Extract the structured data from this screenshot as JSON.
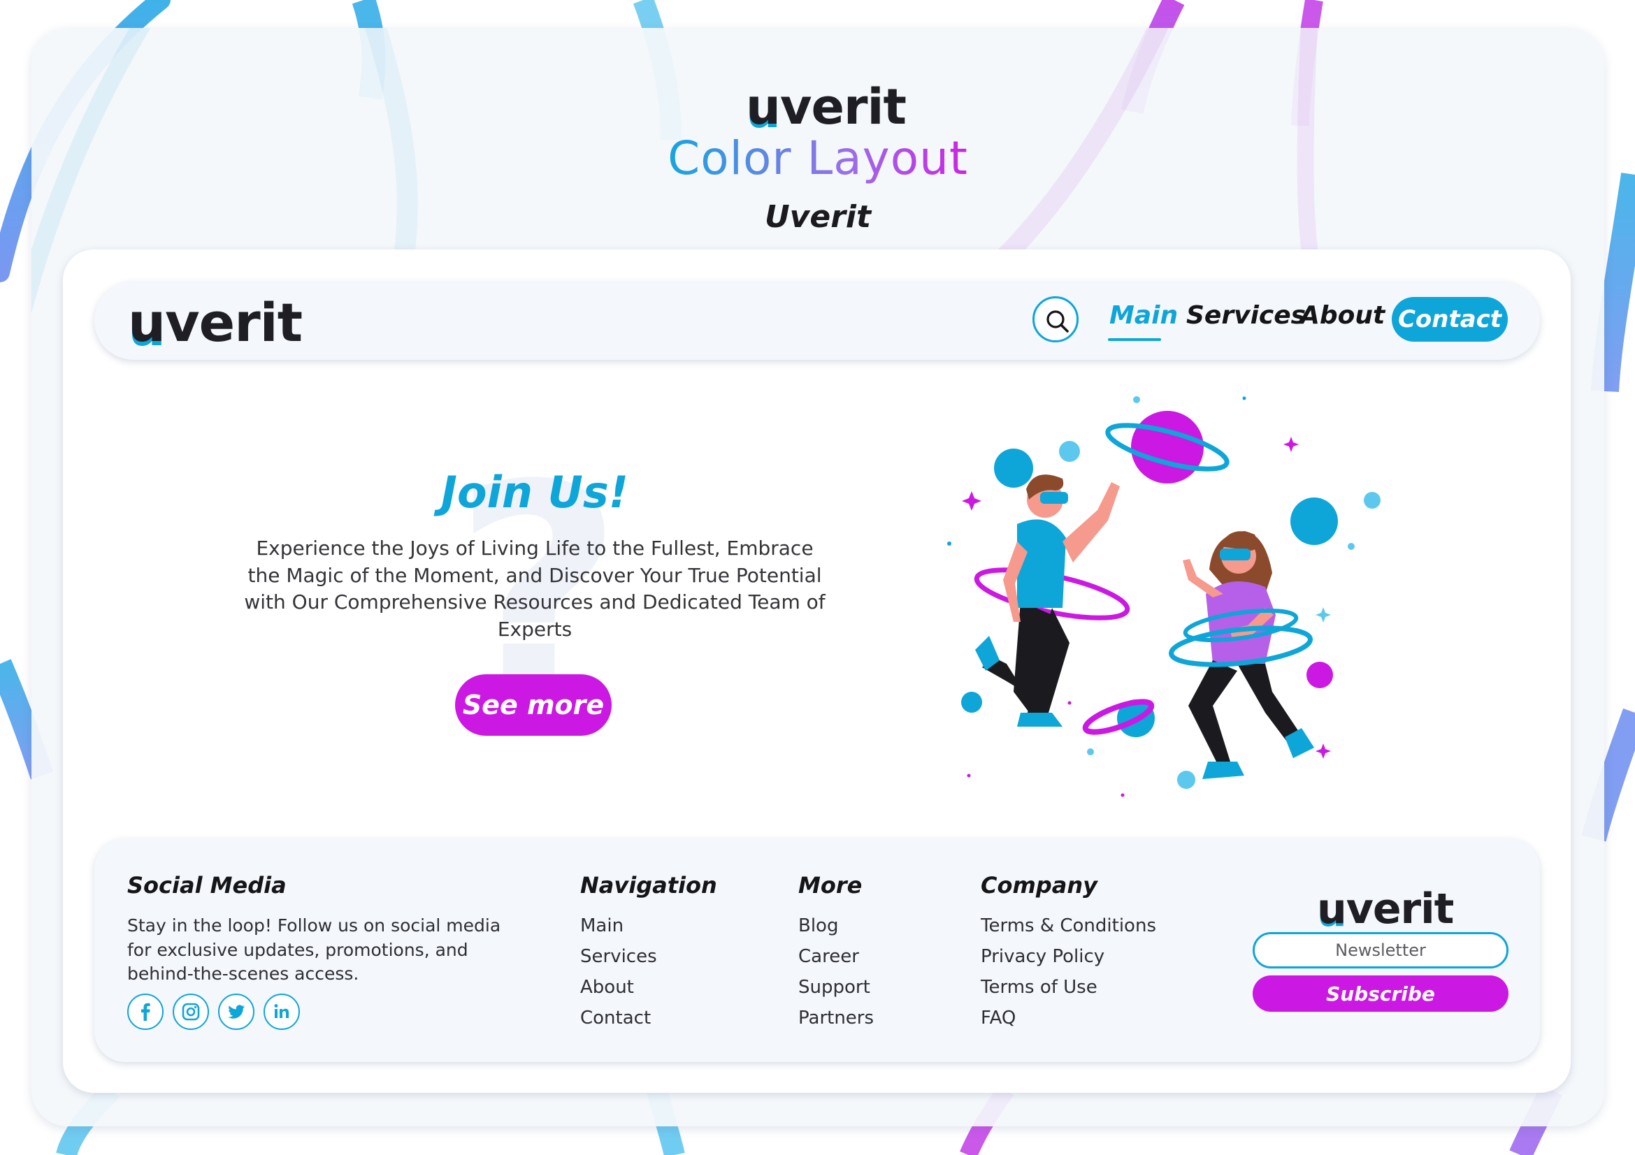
{
  "header": {
    "brand": "uverit",
    "title": "Color Layout",
    "subtitle": "Uverit"
  },
  "navbar": {
    "brand": "uverit",
    "links": [
      {
        "label": "Main",
        "active": true
      },
      {
        "label": "Services",
        "active": false
      },
      {
        "label": "About",
        "active": false
      }
    ],
    "contact_label": "Contact"
  },
  "hero": {
    "title": "Join Us!",
    "text": "Experience the Joys of Living Life to the Fullest, Embrace the Magic of the Moment, and Discover Your True Potential with Our Comprehensive Resources and Dedicated Team of Experts",
    "button_label": "See more"
  },
  "footer": {
    "social": {
      "heading": "Social Media",
      "text": "Stay in the loop! Follow us on social media for exclusive updates, promotions, and behind-the-scenes access.",
      "icons": [
        "facebook-icon",
        "instagram-icon",
        "twitter-icon",
        "linkedin-icon"
      ]
    },
    "navigation": {
      "heading": "Navigation",
      "links": [
        "Main",
        "Services",
        "About",
        "Contact"
      ]
    },
    "more": {
      "heading": "More",
      "links": [
        "Blog",
        "Career",
        "Support",
        "Partners"
      ]
    },
    "company": {
      "heading": "Company",
      "links": [
        "Terms & Conditions",
        "Privacy Policy",
        "Terms of Use",
        "FAQ"
      ]
    },
    "brand": "uverit",
    "newsletter_placeholder": "Newsletter",
    "subscribe_label": "Subscribe"
  },
  "colors": {
    "primary": "#0ea5d8",
    "accent": "#cb18e2",
    "text": "#1b1b1f",
    "surface": "#f4f7fb"
  }
}
